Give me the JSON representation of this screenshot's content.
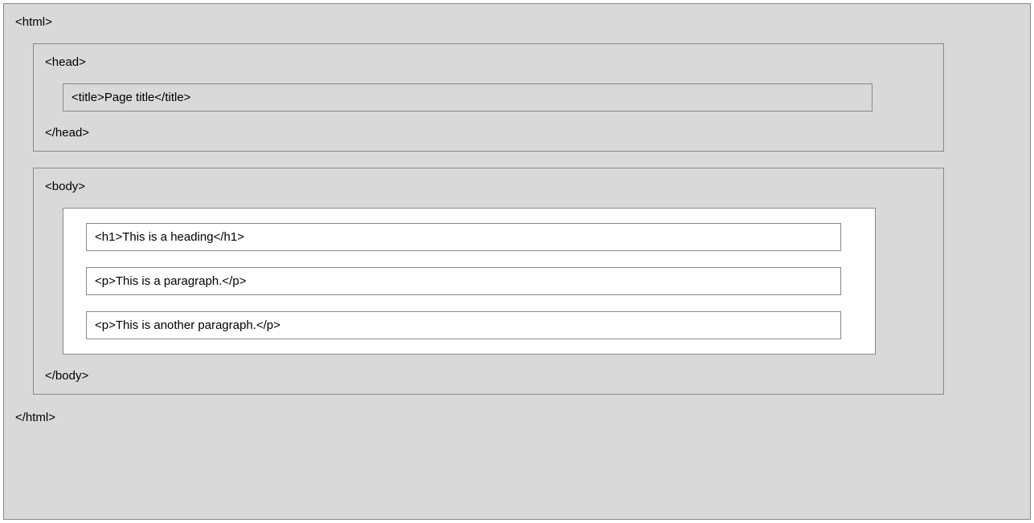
{
  "html_open": "<html>",
  "html_close": "</html>",
  "head_open": "<head>",
  "head_close": "</head>",
  "title_line": "<title>Page title</title>",
  "body_open": "<body>",
  "body_close": "</body>",
  "h1_line": "<h1>This is a heading</h1>",
  "p1_line": "<p>This is a paragraph.</p>",
  "p2_line": "<p>This is another paragraph.</p>"
}
